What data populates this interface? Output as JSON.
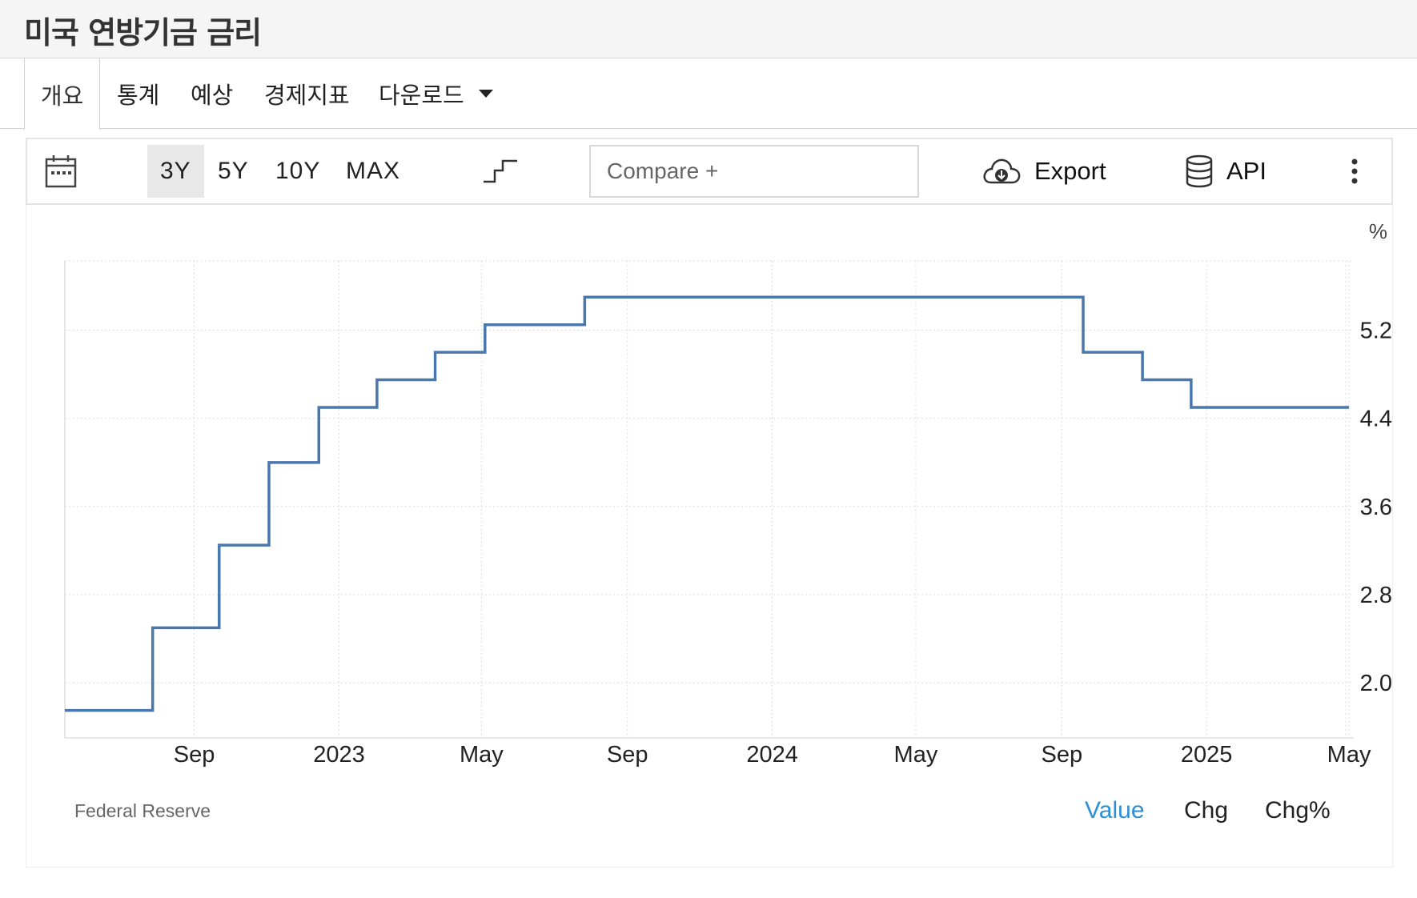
{
  "header": {
    "title": "미국 연방기금 금리"
  },
  "tabs": [
    {
      "label": "개요",
      "active": true
    },
    {
      "label": "통계"
    },
    {
      "label": "예상"
    },
    {
      "label": "경제지표"
    },
    {
      "label": "다운로드"
    }
  ],
  "toolbar": {
    "calendar_icon": "calendar-icon",
    "ranges": [
      "3Y",
      "5Y",
      "10Y",
      "MAX"
    ],
    "active_range": "3Y",
    "chart_style_icon": "step-line-icon",
    "compare_placeholder": "Compare +",
    "export_label": "Export",
    "export_icon": "cloud-download-icon",
    "api_label": "API",
    "api_icon": "database-icon",
    "more_icon": "more-vertical-icon"
  },
  "footer": {
    "source": "Federal Reserve",
    "views": [
      "Value",
      "Chg",
      "Chg%"
    ],
    "active_view": "Value"
  },
  "colors": {
    "line": "#4a78ad",
    "accent": "#2a8fd8",
    "grid": "#dcdcdc"
  },
  "chart_data": {
    "type": "line",
    "step": true,
    "ylabel": "%",
    "yaxis_position": "right",
    "ylim": [
      1.5,
      5.8
    ],
    "yticks": [
      "2.0",
      "2.8",
      "3.6",
      "4.4",
      "5.2"
    ],
    "xlim": [
      "2022-05-15",
      "2025-05-05"
    ],
    "xticks": [
      {
        "date": "2022-09-01",
        "label": "Sep"
      },
      {
        "date": "2023-01-01",
        "label": "2023"
      },
      {
        "date": "2023-05-01",
        "label": "May"
      },
      {
        "date": "2023-09-01",
        "label": "Sep"
      },
      {
        "date": "2024-01-01",
        "label": "2024"
      },
      {
        "date": "2024-05-01",
        "label": "May"
      },
      {
        "date": "2024-09-01",
        "label": "Sep"
      },
      {
        "date": "2025-01-01",
        "label": "2025"
      },
      {
        "date": "2025-05-01",
        "label": "May"
      }
    ],
    "grid": true,
    "series": [
      {
        "points": [
          {
            "x": "2022-05-15",
            "y": 1.75
          },
          {
            "x": "2022-07-28",
            "y": 2.5
          },
          {
            "x": "2022-09-22",
            "y": 3.25
          },
          {
            "x": "2022-11-03",
            "y": 4.0
          },
          {
            "x": "2022-12-15",
            "y": 4.5
          },
          {
            "x": "2023-02-02",
            "y": 4.75
          },
          {
            "x": "2023-03-23",
            "y": 5.0
          },
          {
            "x": "2023-05-04",
            "y": 5.25
          },
          {
            "x": "2023-07-27",
            "y": 5.5
          },
          {
            "x": "2024-09-19",
            "y": 5.0
          },
          {
            "x": "2024-11-08",
            "y": 4.75
          },
          {
            "x": "2024-12-19",
            "y": 4.5
          },
          {
            "x": "2025-05-01",
            "y": 4.5
          }
        ]
      }
    ]
  }
}
